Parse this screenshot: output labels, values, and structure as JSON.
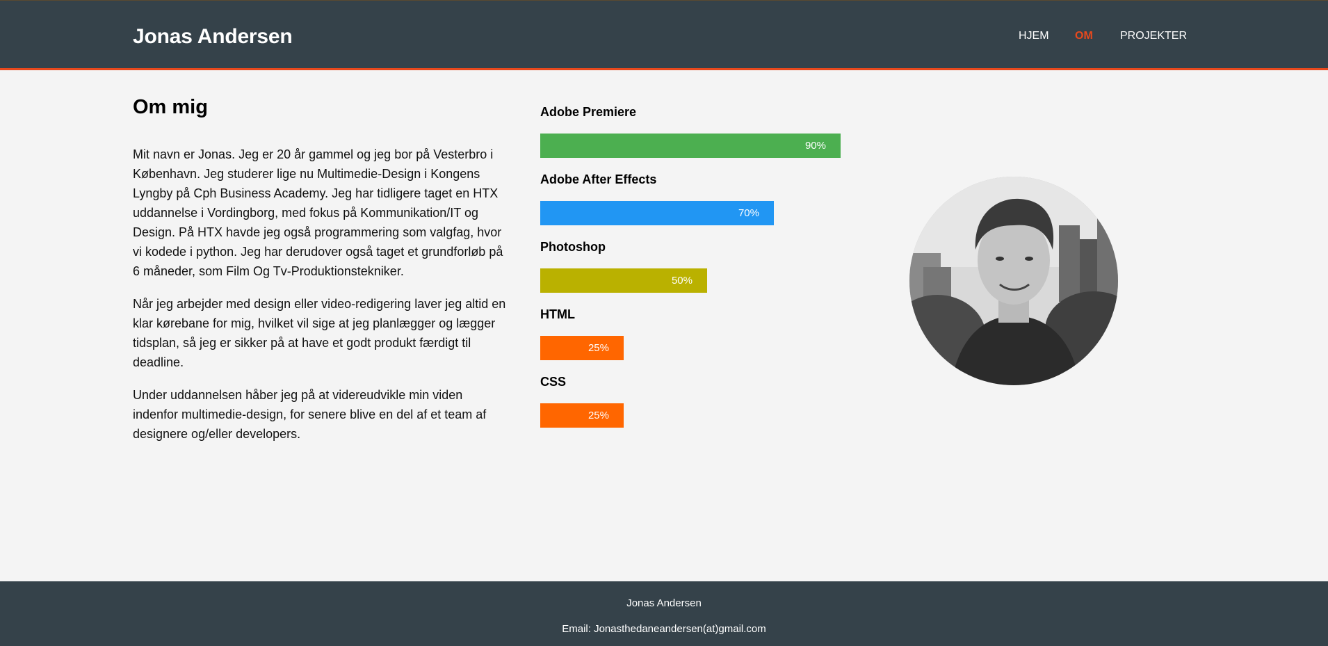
{
  "header": {
    "site_name": "Jonas Andersen",
    "nav": [
      {
        "label": "HJEM",
        "active": false
      },
      {
        "label": "OM",
        "active": true
      },
      {
        "label": "PROJEKTER",
        "active": false
      }
    ]
  },
  "about": {
    "title": "Om mig",
    "paragraphs": [
      "Mit navn er Jonas. Jeg er 20 år gammel og jeg bor på Vesterbro i København. Jeg studerer lige nu Multimedie-Design i Kongens Lyngby på Cph Business Academy. Jeg har tidligere taget en HTX uddannelse i Vordingborg, med fokus på Kommunikation/IT og Design. På HTX havde jeg også programmering som valgfag, hvor vi kodede i python. Jeg har derudover også taget et grundforløb på 6 måneder, som Film Og Tv-Produktionstekniker.",
      "Når jeg arbejder med design eller video-redigering laver jeg altid en klar kørebane for mig, hvilket vil sige at jeg planlægger og lægger tidsplan, så jeg er sikker på at have et godt produkt færdigt til deadline.",
      "Under uddannelsen håber jeg på at videreudvikle min viden indenfor multimedie-design, for senere blive en del af et team af designere og/eller developers."
    ]
  },
  "skills": [
    {
      "name": "Adobe Premiere",
      "value": 90,
      "label": "90%",
      "color": "#4caf50"
    },
    {
      "name": "Adobe After Effects",
      "value": 70,
      "label": "70%",
      "color": "#2196f3"
    },
    {
      "name": "Photoshop",
      "value": 50,
      "label": "50%",
      "color": "#bab100"
    },
    {
      "name": "HTML",
      "value": 25,
      "label": "25%",
      "color": "#ff6600"
    },
    {
      "name": "CSS",
      "value": 25,
      "label": "25%",
      "color": "#ff6600"
    }
  ],
  "footer": {
    "name": "Jonas Andersen",
    "email": "Email: Jonasthedaneandersen(at)gmail.com"
  },
  "colors": {
    "header_bg": "#35424a",
    "accent": "#e8491d",
    "page_bg": "#f4f4f4"
  }
}
